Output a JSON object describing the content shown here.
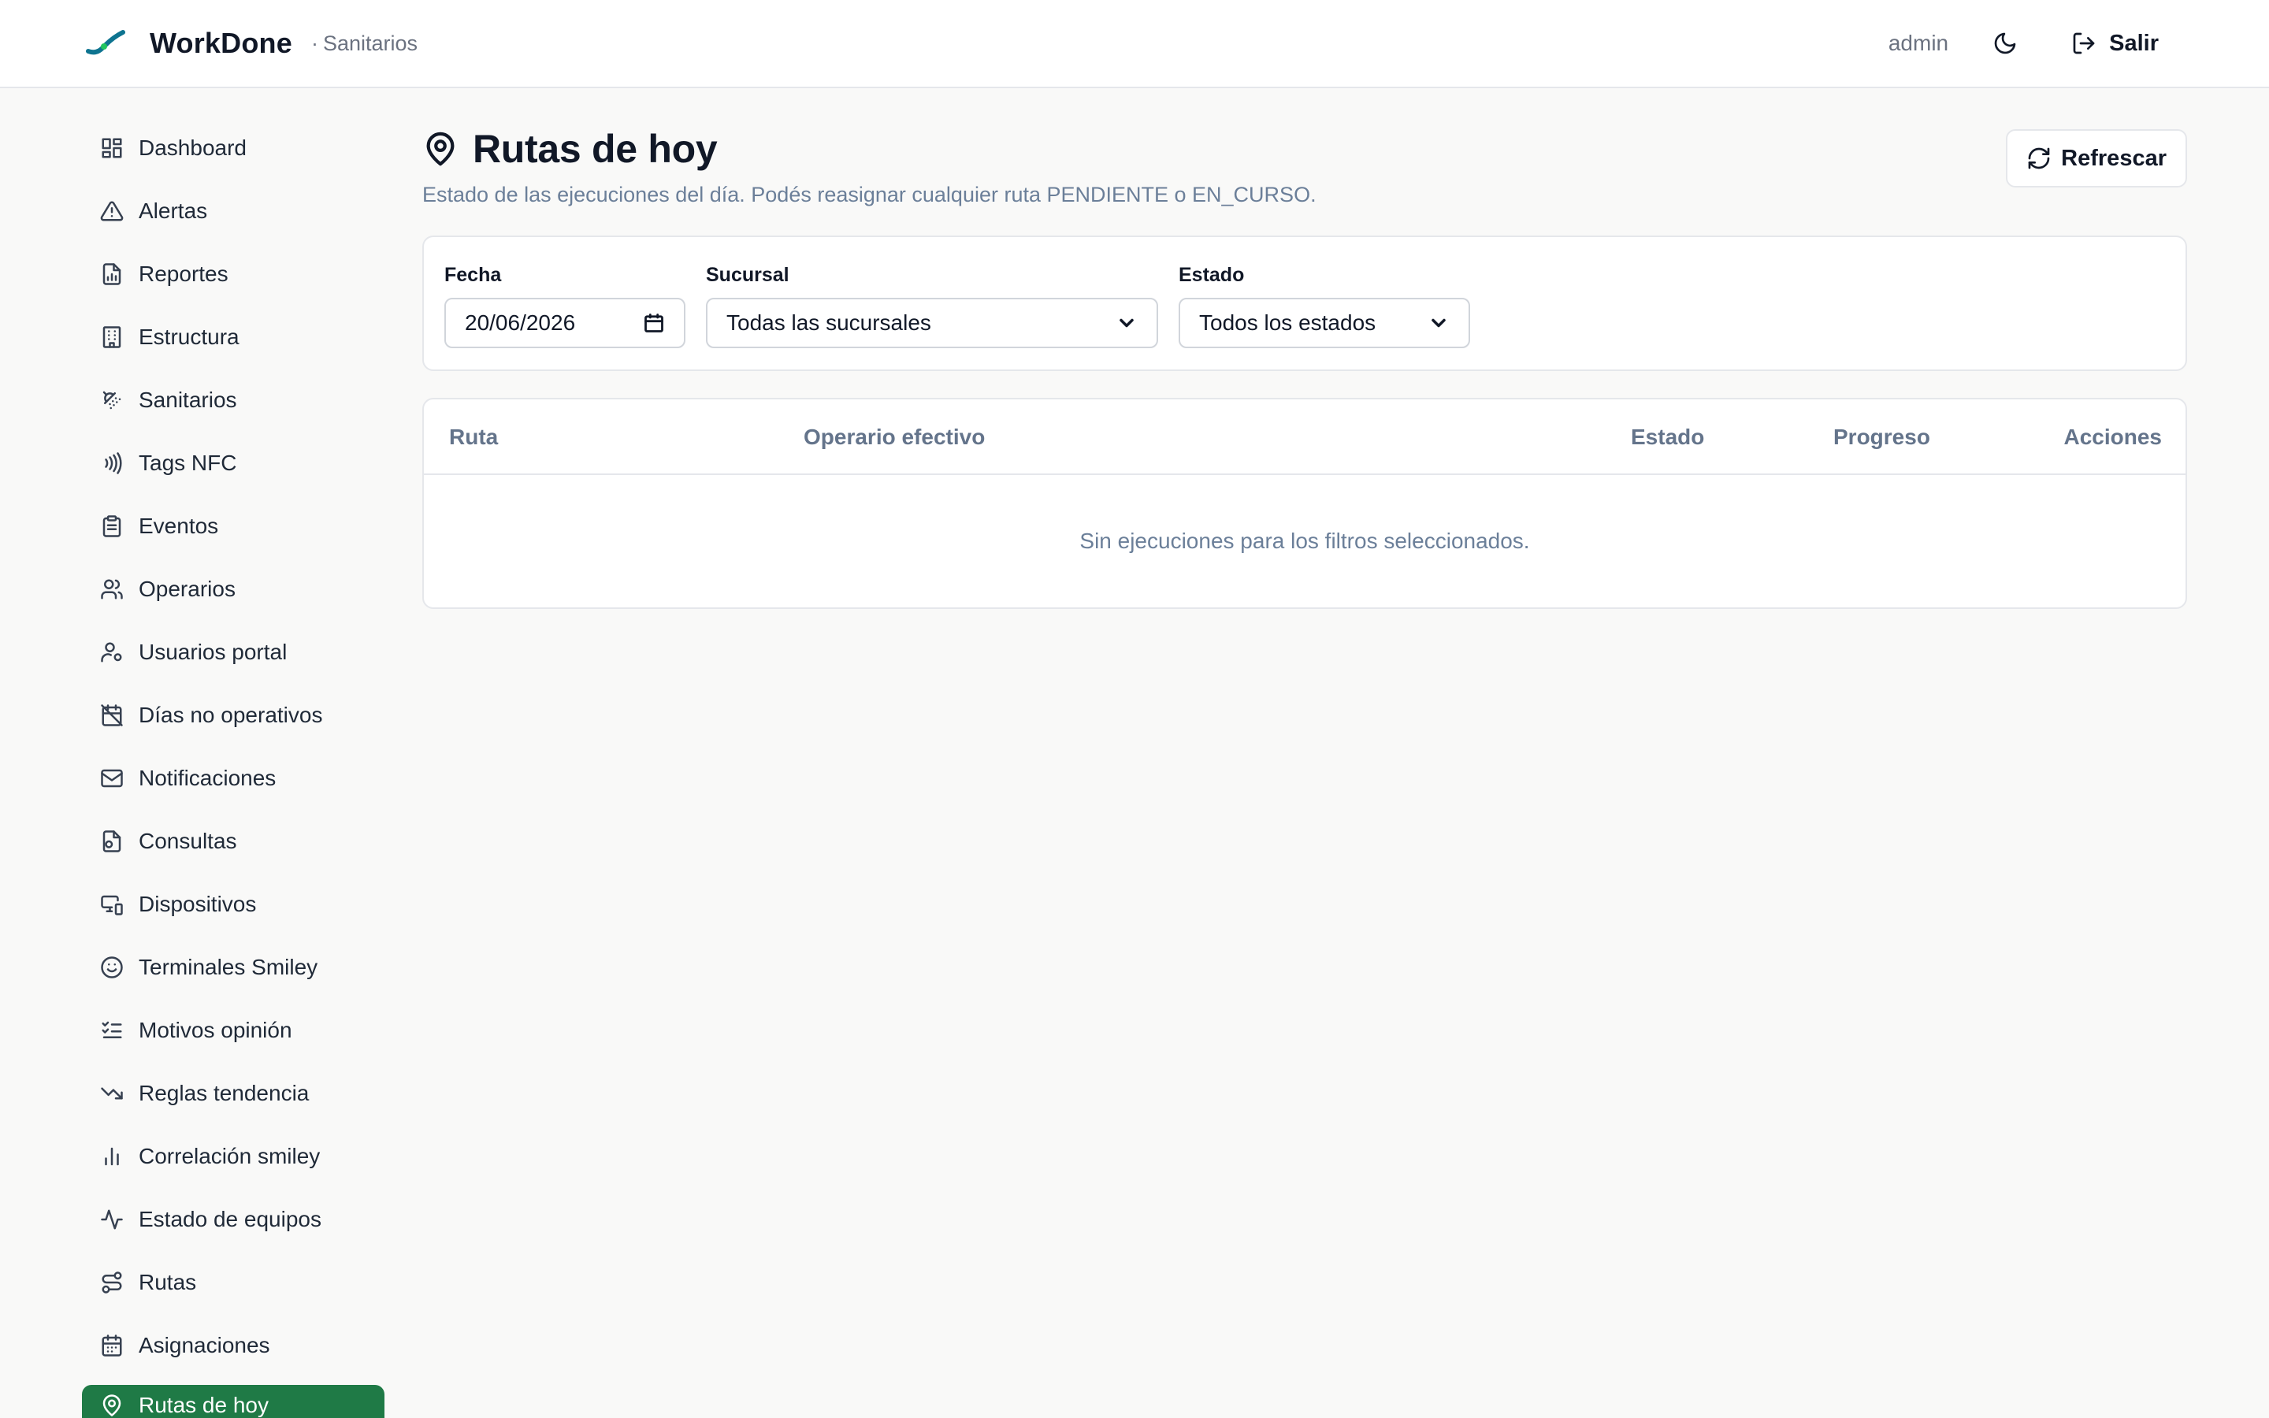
{
  "header": {
    "brand_name": "WorkDone",
    "section_sep": "·",
    "section_name": "Sanitarios",
    "user_name": "admin",
    "logout_label": "Salir"
  },
  "sidebar": {
    "items": [
      {
        "label": "Dashboard",
        "icon": "dashboard-grid-icon"
      },
      {
        "label": "Alertas",
        "icon": "alert-triangle-icon"
      },
      {
        "label": "Reportes",
        "icon": "report-file-icon"
      },
      {
        "label": "Estructura",
        "icon": "building-icon"
      },
      {
        "label": "Sanitarios",
        "icon": "shower-icon"
      },
      {
        "label": "Tags NFC",
        "icon": "nfc-icon"
      },
      {
        "label": "Eventos",
        "icon": "clipboard-icon"
      },
      {
        "label": "Operarios",
        "icon": "users-icon"
      },
      {
        "label": "Usuarios portal",
        "icon": "user-cog-icon"
      },
      {
        "label": "Días no operativos",
        "icon": "calendar-off-icon"
      },
      {
        "label": "Notificaciones",
        "icon": "mail-icon"
      },
      {
        "label": "Consultas",
        "icon": "file-question-icon"
      },
      {
        "label": "Dispositivos",
        "icon": "devices-icon"
      },
      {
        "label": "Terminales Smiley",
        "icon": "smile-icon"
      },
      {
        "label": "Motivos opinión",
        "icon": "list-check-icon"
      },
      {
        "label": "Reglas tendencia",
        "icon": "trending-down-icon"
      },
      {
        "label": "Correlación smiley",
        "icon": "bar-chart-icon"
      },
      {
        "label": "Estado de equipos",
        "icon": "activity-icon"
      },
      {
        "label": "Rutas",
        "icon": "route-icon"
      },
      {
        "label": "Asignaciones",
        "icon": "calendar-icon"
      },
      {
        "label": "Rutas de hoy",
        "icon": "map-pin-icon",
        "active": true
      }
    ]
  },
  "main": {
    "title": "Rutas de hoy",
    "subtitle": "Estado de las ejecuciones del día. Podés reasignar cualquier ruta PENDIENTE o EN_CURSO.",
    "refresh_label": "Refrescar",
    "filters": {
      "date_label": "Fecha",
      "date_value": "20/06/2026",
      "branch_label": "Sucursal",
      "branch_value": "Todas las sucursales",
      "status_label": "Estado",
      "status_value": "Todos los estados"
    },
    "table": {
      "columns": [
        "Ruta",
        "Operario efectivo",
        "Estado",
        "Progreso",
        "Acciones"
      ],
      "empty_message": "Sin ejecuciones para los filtros seleccionados."
    }
  },
  "colors": {
    "accent_green": "#1f7a46",
    "logo_teal": "#0e7490",
    "logo_green": "#22c55e",
    "muted_text": "#6b7f99"
  }
}
